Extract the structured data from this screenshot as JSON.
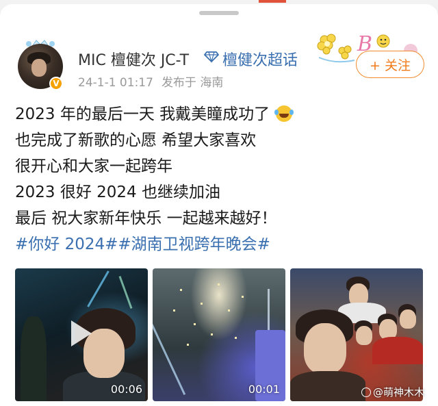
{
  "post": {
    "author": {
      "name": "MIC 檀健次 JC-T",
      "topic_link": "檀健次超话",
      "verified_badge": "V"
    },
    "time": "24-1-1 01:17",
    "location": "发布于 海南",
    "follow_label": "+ 关注",
    "text_lines": [
      "2023 年的最后一天 我戴美瞳成功了",
      "也完成了新歌的心愿 希望大家喜欢",
      "很开心和大家一起跨年",
      "2023 很好  2024 也继续加油",
      "最后 祝大家新年快乐 一起越来越好！"
    ],
    "hashtags": "#你好 2024##湖南卫视跨年晚会#",
    "media": [
      {
        "type": "video",
        "duration": "00:06"
      },
      {
        "type": "video",
        "duration": "00:01"
      },
      {
        "type": "image",
        "watermark": "@萌神木木"
      }
    ]
  },
  "icons": {
    "emoji": "laughing-with-tears-icon",
    "topic": "diamond-icon",
    "play": "play-icon"
  },
  "colors": {
    "link": "#3a6fb0",
    "follow": "#f07a1a",
    "badge": "#f5a100"
  }
}
